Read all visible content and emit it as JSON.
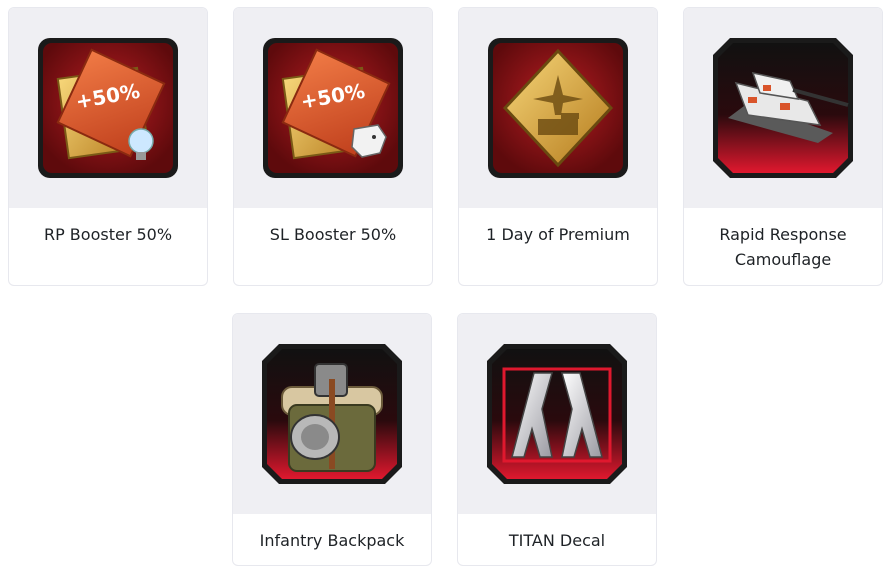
{
  "rewards": [
    {
      "name": "RP Booster 50%",
      "icon": "rp-booster-icon",
      "badge": "+50%"
    },
    {
      "name": "SL Booster 50%",
      "icon": "sl-booster-icon",
      "badge": "+50%"
    },
    {
      "name": "1 Day of Premium",
      "icon": "premium-icon"
    },
    {
      "name": "Rapid Response Camouflage",
      "icon": "camouflage-tank-icon"
    },
    {
      "name": "Infantry Backpack",
      "icon": "backpack-icon"
    },
    {
      "name": "TITAN Decal",
      "icon": "titan-decal-icon"
    }
  ],
  "colors": {
    "card_bg": "#efeff3",
    "card_border": "#e7e8ee",
    "booster_red": "#a0161b",
    "decal_red": "#e0182e",
    "gold": "#d9a83a",
    "orange": "#d9542a"
  }
}
